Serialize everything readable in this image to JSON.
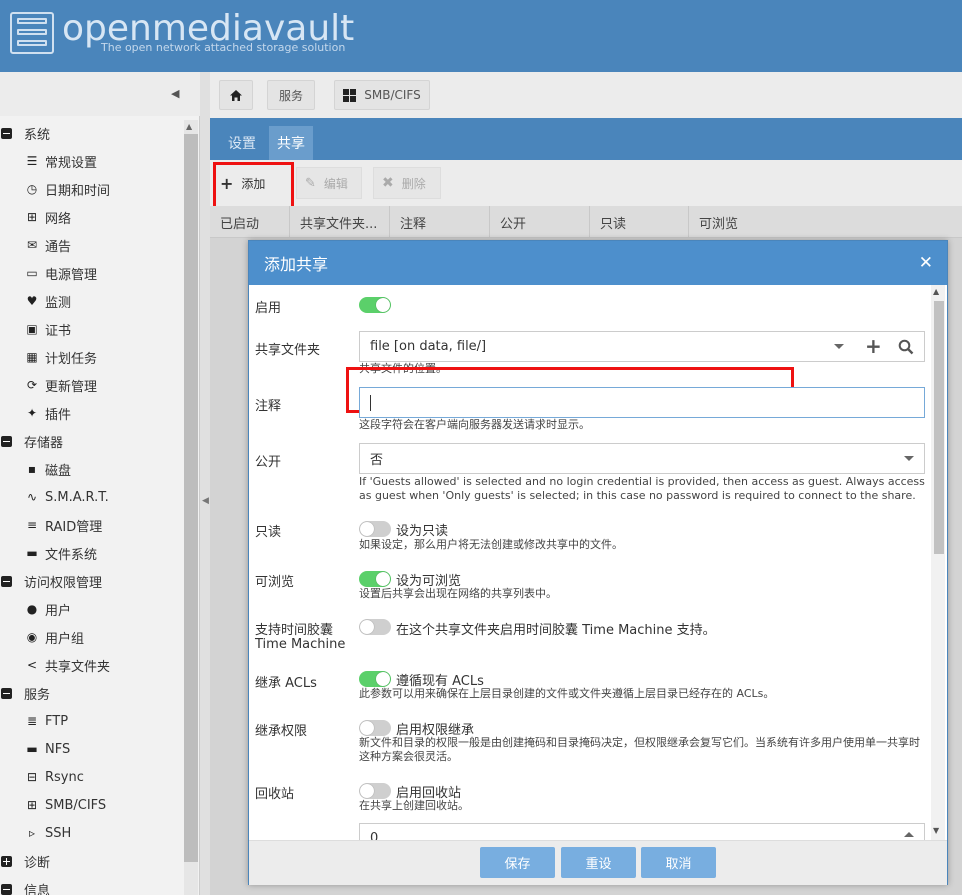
{
  "brand": {
    "name": "openmediavault",
    "tagline": "The open network attached storage solution"
  },
  "breadcrumb": {
    "home_icon": "home-icon",
    "services": "服务",
    "smb": "SMB/CIFS"
  },
  "sidebar": {
    "items": [
      {
        "type": "group",
        "label": "系统",
        "icon": "minus-square-icon"
      },
      {
        "type": "child",
        "label": "常规设置",
        "icon": "sliders-icon"
      },
      {
        "type": "child",
        "label": "日期和时间",
        "icon": "clock-icon"
      },
      {
        "type": "child",
        "label": "网络",
        "icon": "network-icon"
      },
      {
        "type": "child",
        "label": "通告",
        "icon": "envelope-icon"
      },
      {
        "type": "child",
        "label": "电源管理",
        "icon": "battery-icon"
      },
      {
        "type": "child",
        "label": "监测",
        "icon": "heartbeat-icon"
      },
      {
        "type": "child",
        "label": "证书",
        "icon": "certificate-icon"
      },
      {
        "type": "child",
        "label": "计划任务",
        "icon": "calendar-clock-icon"
      },
      {
        "type": "child",
        "label": "更新管理",
        "icon": "refresh-icon"
      },
      {
        "type": "child",
        "label": "插件",
        "icon": "puzzle-icon"
      },
      {
        "type": "group",
        "label": "存储器",
        "icon": "minus-square-icon"
      },
      {
        "type": "child",
        "label": "磁盘",
        "icon": "disk-icon"
      },
      {
        "type": "child",
        "label": "S.M.A.R.T.",
        "icon": "pulse-icon"
      },
      {
        "type": "child",
        "label": "RAID管理",
        "icon": "database-icon"
      },
      {
        "type": "child",
        "label": "文件系统",
        "icon": "folder-icon"
      },
      {
        "type": "group",
        "label": "访问权限管理",
        "icon": "minus-square-icon"
      },
      {
        "type": "child",
        "label": "用户",
        "icon": "user-icon"
      },
      {
        "type": "child",
        "label": "用户组",
        "icon": "users-icon"
      },
      {
        "type": "child",
        "label": "共享文件夹",
        "icon": "share-icon"
      },
      {
        "type": "group",
        "label": "服务",
        "icon": "minus-square-icon"
      },
      {
        "type": "child",
        "label": "FTP",
        "icon": "server-icon"
      },
      {
        "type": "child",
        "label": "NFS",
        "icon": "desktop-icon"
      },
      {
        "type": "child",
        "label": "Rsync",
        "icon": "sitemap-icon"
      },
      {
        "type": "child",
        "label": "SMB/CIFS",
        "icon": "windows-icon"
      },
      {
        "type": "child",
        "label": "SSH",
        "icon": "terminal-icon"
      },
      {
        "type": "group",
        "label": "诊断",
        "icon": "plus-square-icon"
      },
      {
        "type": "group",
        "label": "信息",
        "icon": "minus-square-icon"
      }
    ]
  },
  "tabs": {
    "settings": "设置",
    "share": "共享"
  },
  "toolbar": {
    "add": "添加",
    "edit": "编辑",
    "delete": "删除"
  },
  "grid": {
    "columns": [
      "已启动",
      "共享文件夹...",
      "注释",
      "公开",
      "只读",
      "可浏览"
    ]
  },
  "dialog": {
    "title": "添加共享",
    "enable": {
      "label": "启用",
      "on": true
    },
    "shared_folder": {
      "label": "共享文件夹",
      "value": "file [on data, file/]",
      "hint": "共享文件的位置。"
    },
    "comment": {
      "label": "注释",
      "value": "",
      "hint": "这段字符会在客户端向服务器发送请求时显示。"
    },
    "public": {
      "label": "公开",
      "value": "否",
      "hint": "If 'Guests allowed' is selected and no login credential is provided, then access as guest. Always access as guest when 'Only guests' is selected; in this case no password is required to connect to the share."
    },
    "readonly": {
      "label": "只读",
      "toggle_label": "设为只读",
      "on": false,
      "hint": "如果设定，那么用户将无法创建或修改共享中的文件。"
    },
    "browsable": {
      "label": "可浏览",
      "toggle_label": "设为可浏览",
      "on": true,
      "hint": "设置后共享会出现在网络的共享列表中。"
    },
    "time_machine": {
      "label": "支持时间胶囊",
      "label2": "Time Machine",
      "toggle_label": "在这个共享文件夹启用时间胶囊 Time Machine 支持。",
      "on": false
    },
    "inherit_acls": {
      "label": "继承 ACLs",
      "toggle_label": "遵循现有 ACLs",
      "on": true,
      "hint": "此参数可以用来确保在上层目录创建的文件或文件夹遵循上层目录已经存在的 ACLs。"
    },
    "inherit_perms": {
      "label": "继承权限",
      "toggle_label": "启用权限继承",
      "on": false,
      "hint": "新文件和目录的权限一般是由创建掩码和目录掩码决定，但权限继承会复写它们。当系统有许多用户使用单一共享时这种方案会很灵活。"
    },
    "recycle": {
      "label": "回收站",
      "toggle_label": "启用回收站",
      "on": false,
      "hint": "在共享上创建回收站。"
    },
    "next_field_value": "0",
    "buttons": {
      "save": "保存",
      "reset": "重设",
      "cancel": "取消"
    }
  },
  "colors": {
    "header": "#4a85bb",
    "accent": "#4d8fcc",
    "toggle_on": "#5bd06a",
    "highlight": "#e11111"
  }
}
